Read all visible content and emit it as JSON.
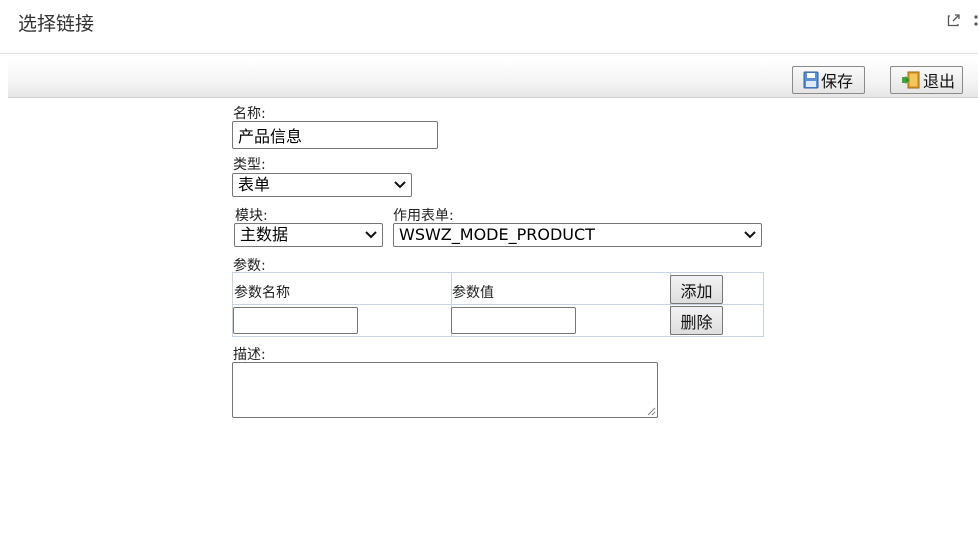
{
  "window": {
    "title": "选择链接",
    "icons": [
      "expand-icon",
      "more-icon"
    ]
  },
  "toolbar": {
    "save_label": "保存",
    "exit_label": "退出"
  },
  "form": {
    "name": {
      "label": "名称:",
      "value": "产品信息"
    },
    "type": {
      "label": "类型:",
      "value": "表单"
    },
    "module": {
      "label": "模块:",
      "value": "主数据"
    },
    "target_form": {
      "label": "作用表单:",
      "value": "WSWZ_MODE_PRODUCT"
    },
    "params": {
      "label": "参数:",
      "col_name": "参数名称",
      "col_value": "参数值",
      "add_label": "添加",
      "delete_label": "删除",
      "row": {
        "name": "",
        "value": ""
      }
    },
    "description": {
      "label": "描述:",
      "value": ""
    }
  }
}
